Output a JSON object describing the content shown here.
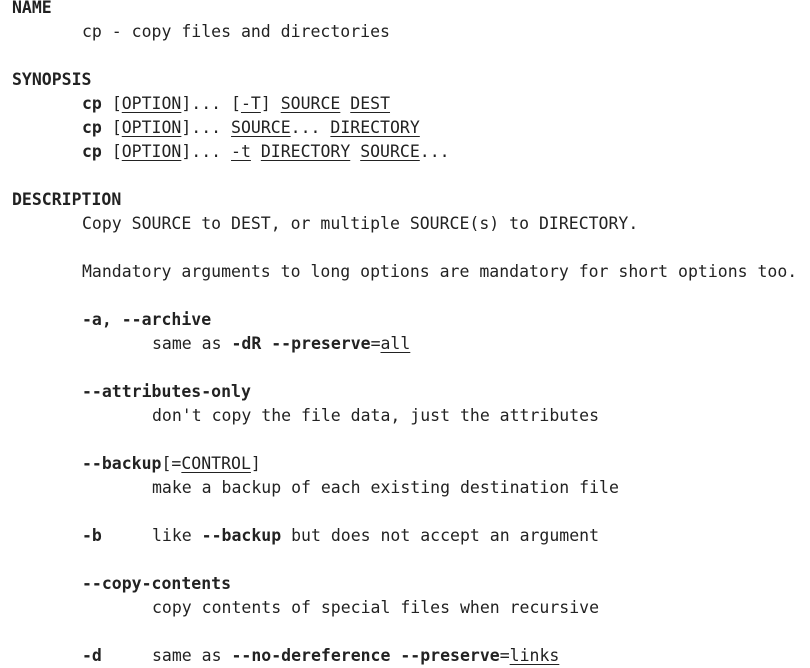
{
  "sections": {
    "name": {
      "heading": "NAME",
      "text": "cp - copy files and directories"
    },
    "synopsis": {
      "heading": "SYNOPSIS",
      "lines": [
        [
          {
            "t": "cp",
            "s": "b"
          },
          {
            "t": " ",
            "s": ""
          },
          {
            "t": "[",
            "s": ""
          },
          {
            "t": "OPTION",
            "s": "u"
          },
          {
            "t": "]... ",
            "s": ""
          },
          {
            "t": "[",
            "s": ""
          },
          {
            "t": "-T",
            "s": "u"
          },
          {
            "t": "] ",
            "s": ""
          },
          {
            "t": "SOURCE",
            "s": "u"
          },
          {
            "t": " ",
            "s": ""
          },
          {
            "t": "DEST",
            "s": "u"
          }
        ],
        [
          {
            "t": "cp",
            "s": "b"
          },
          {
            "t": " ",
            "s": ""
          },
          {
            "t": "[",
            "s": ""
          },
          {
            "t": "OPTION",
            "s": "u"
          },
          {
            "t": "]... ",
            "s": ""
          },
          {
            "t": "SOURCE",
            "s": "u"
          },
          {
            "t": "... ",
            "s": ""
          },
          {
            "t": "DIRECTORY",
            "s": "u"
          }
        ],
        [
          {
            "t": "cp",
            "s": "b"
          },
          {
            "t": " ",
            "s": ""
          },
          {
            "t": "[",
            "s": ""
          },
          {
            "t": "OPTION",
            "s": "u"
          },
          {
            "t": "]... ",
            "s": ""
          },
          {
            "t": "-t",
            "s": "u"
          },
          {
            "t": " ",
            "s": ""
          },
          {
            "t": "DIRECTORY",
            "s": "u"
          },
          {
            "t": " ",
            "s": ""
          },
          {
            "t": "SOURCE",
            "s": "u"
          },
          {
            "t": "...",
            "s": ""
          }
        ]
      ]
    },
    "description": {
      "heading": "DESCRIPTION",
      "text1": "Copy SOURCE to DEST, or multiple SOURCE(s) to DIRECTORY.",
      "text2": "Mandatory arguments to long options are mandatory for short options too.",
      "options": {
        "archive": {
          "term": [
            {
              "t": "-a, --archive",
              "s": "b"
            }
          ],
          "desc": [
            {
              "t": "same as ",
              "s": ""
            },
            {
              "t": "-dR --preserve",
              "s": "b"
            },
            {
              "t": "=",
              "s": ""
            },
            {
              "t": "all",
              "s": "u"
            }
          ]
        },
        "attributes_only": {
          "term": [
            {
              "t": "--attributes-only",
              "s": "b"
            }
          ],
          "desc": [
            {
              "t": "don't copy the file data, just the attributes",
              "s": ""
            }
          ]
        },
        "backup": {
          "term": [
            {
              "t": "--backup",
              "s": "b"
            },
            {
              "t": "[=",
              "s": ""
            },
            {
              "t": "CONTROL",
              "s": "u"
            },
            {
              "t": "]",
              "s": ""
            }
          ],
          "desc": [
            {
              "t": "make a backup of each existing destination file",
              "s": ""
            }
          ]
        },
        "b_opt": {
          "term": [
            {
              "t": "-b",
              "s": "b"
            }
          ],
          "desc": [
            {
              "t": "like ",
              "s": ""
            },
            {
              "t": "--backup",
              "s": "b"
            },
            {
              "t": " but does not accept an argument",
              "s": ""
            }
          ]
        },
        "copy_contents": {
          "term": [
            {
              "t": "--copy-contents",
              "s": "b"
            }
          ],
          "desc": [
            {
              "t": "copy contents of special files when recursive",
              "s": ""
            }
          ]
        },
        "d_opt": {
          "term": [
            {
              "t": "-d",
              "s": "b"
            }
          ],
          "desc": [
            {
              "t": "same as ",
              "s": ""
            },
            {
              "t": "--no-dereference --preserve",
              "s": "b"
            },
            {
              "t": "=",
              "s": ""
            },
            {
              "t": "links",
              "s": "u"
            }
          ]
        }
      }
    }
  }
}
